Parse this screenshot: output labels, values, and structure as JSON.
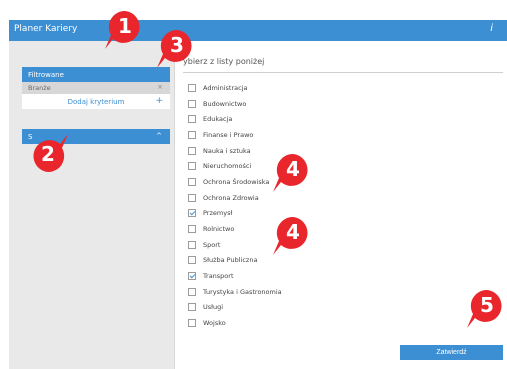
{
  "app": {
    "title": "Planer Kariery",
    "info_icon": "info-icon"
  },
  "sidebar": {
    "filter_heading": "Filtrowane",
    "selected_filter": {
      "label": "Branże",
      "remove_icon": "close-icon"
    },
    "add_criterion": {
      "label": "Dodaj kryterium",
      "icon": "plus-icon"
    },
    "second_panel": {
      "label": "S",
      "icon": "chevron-up-icon"
    }
  },
  "main": {
    "heading": "ybierz z listy poniżej",
    "options": [
      {
        "label": "Administracja",
        "checked": false
      },
      {
        "label": "Budownictwo",
        "checked": false
      },
      {
        "label": "Edukacja",
        "checked": false
      },
      {
        "label": "Finanse i Prawo",
        "checked": false
      },
      {
        "label": "Nauka i sztuka",
        "checked": false
      },
      {
        "label": "Nieruchomości",
        "checked": false
      },
      {
        "label": "Ochrona Środowiska",
        "checked": false
      },
      {
        "label": "Ochrona Zdrowia",
        "checked": false
      },
      {
        "label": "Przemysł",
        "checked": true
      },
      {
        "label": "Rolnictwo",
        "checked": false
      },
      {
        "label": "Sport",
        "checked": false
      },
      {
        "label": "Służba Publiczna",
        "checked": false
      },
      {
        "label": "Transport",
        "checked": true
      },
      {
        "label": "Turystyka i Gastronomia",
        "checked": false
      },
      {
        "label": "Usługi",
        "checked": false
      },
      {
        "label": "Wojsko",
        "checked": false
      }
    ],
    "confirm_label": "Zatwierdź"
  },
  "callouts": [
    {
      "number": "1",
      "color": "#e8262b"
    },
    {
      "number": "2",
      "color": "#e8262b"
    },
    {
      "number": "3",
      "color": "#e8262b"
    },
    {
      "number": "4",
      "color": "#e8262b"
    },
    {
      "number": "4",
      "color": "#e8262b"
    },
    {
      "number": "5",
      "color": "#e8262b"
    }
  ],
  "colors": {
    "accent": "#3d8fd3",
    "sidebar_bg": "#e9e9e9",
    "callout": "#e8262b"
  }
}
